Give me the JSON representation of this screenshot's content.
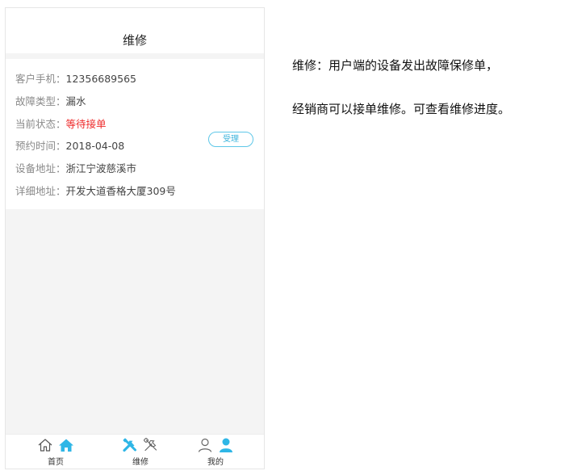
{
  "nav": {
    "title": "维修"
  },
  "order": {
    "rows": [
      {
        "key": "客户手机：",
        "value": "12356689565"
      },
      {
        "key": "故障类型：",
        "value": "漏水"
      },
      {
        "key": "当前状态：",
        "value": "等待接单"
      },
      {
        "key": "预约时间：",
        "value": "2018-04-08"
      },
      {
        "key": "设备地址：",
        "value": "浙江宁波慈溪市"
      },
      {
        "key": "详细地址：",
        "value": "开发大道香格大厦309号"
      }
    ],
    "accept_label": "受理",
    "status_color": "#ee2a2a"
  },
  "tabbar": {
    "tabs": [
      {
        "label": "首页",
        "icons": [
          "home-outline-icon",
          "home-filled-icon"
        ]
      },
      {
        "label": "维修",
        "icons": [
          "tools-filled-icon",
          "tools-outline-icon"
        ]
      },
      {
        "label": "我的",
        "icons": [
          "user-outline-icon",
          "user-filled-icon"
        ]
      }
    ],
    "accent": "#2fb6e6"
  },
  "description": {
    "line1": "维修：用户端的设备发出故障保修单，",
    "line2": "经销商可以接单维修。可查看维修进度。"
  }
}
